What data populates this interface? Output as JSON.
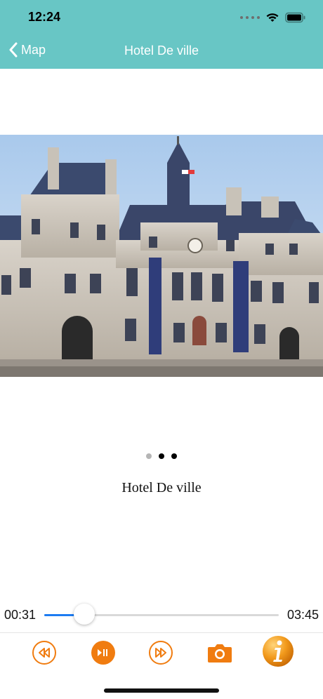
{
  "status": {
    "time": "12:24"
  },
  "nav": {
    "back_label": "Map",
    "title": "Hotel De ville"
  },
  "gallery": {
    "caption": "Hotel De ville",
    "pages": 3,
    "active_page": 2
  },
  "player": {
    "elapsed": "00:31",
    "duration": "03:45",
    "progress": 0.17
  },
  "colors": {
    "header": "#68c6c5",
    "accent": "#f07c10",
    "progress": "#1d7cf2"
  },
  "icons": [
    "rewind-icon",
    "play-pause-icon",
    "fast-forward-icon",
    "camera-icon",
    "info-icon"
  ]
}
